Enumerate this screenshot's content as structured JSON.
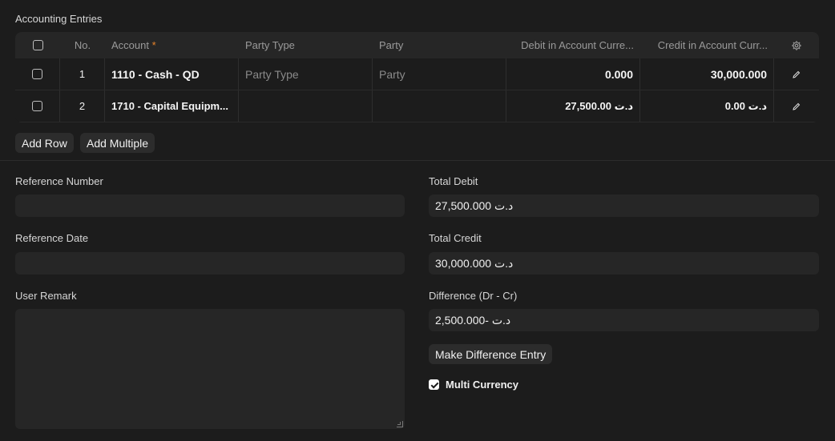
{
  "section_title": "Accounting Entries",
  "grid": {
    "columns": {
      "no": "No.",
      "account": "Account",
      "account_required": "*",
      "party_type": "Party Type",
      "party": "Party",
      "debit": "Debit in Account Curre...",
      "credit": "Credit in Account Curr..."
    },
    "rows": [
      {
        "no": "1",
        "account": "1110 - Cash - QD",
        "party_type": "Party Type",
        "party": "Party",
        "debit": "0.000",
        "credit": "30,000.000",
        "party_type_placeholder": true
      },
      {
        "no": "2",
        "account": "1710 - Capital Equipm...",
        "party_type": "",
        "party": "",
        "debit": "د.ت 27,500.00",
        "credit": "د.ت 0.00",
        "party_type_placeholder": false
      }
    ]
  },
  "buttons": {
    "add_row": "Add Row",
    "add_multiple": "Add Multiple",
    "make_difference": "Make Difference Entry"
  },
  "form": {
    "reference_number_label": "Reference Number",
    "reference_number_value": "",
    "reference_date_label": "Reference Date",
    "reference_date_value": "",
    "user_remark_label": "User Remark",
    "user_remark_value": "",
    "total_debit_label": "Total Debit",
    "total_debit_value": "د.ت 27,500.000",
    "total_credit_label": "Total Credit",
    "total_credit_value": "د.ت 30,000.000",
    "difference_label": "Difference (Dr - Cr)",
    "difference_value": "د.ت -2,500.000",
    "multi_currency_label": "Multi Currency",
    "multi_currency_checked": true
  },
  "icons": {
    "settings": "gear-icon",
    "edit": "pencil-icon"
  }
}
